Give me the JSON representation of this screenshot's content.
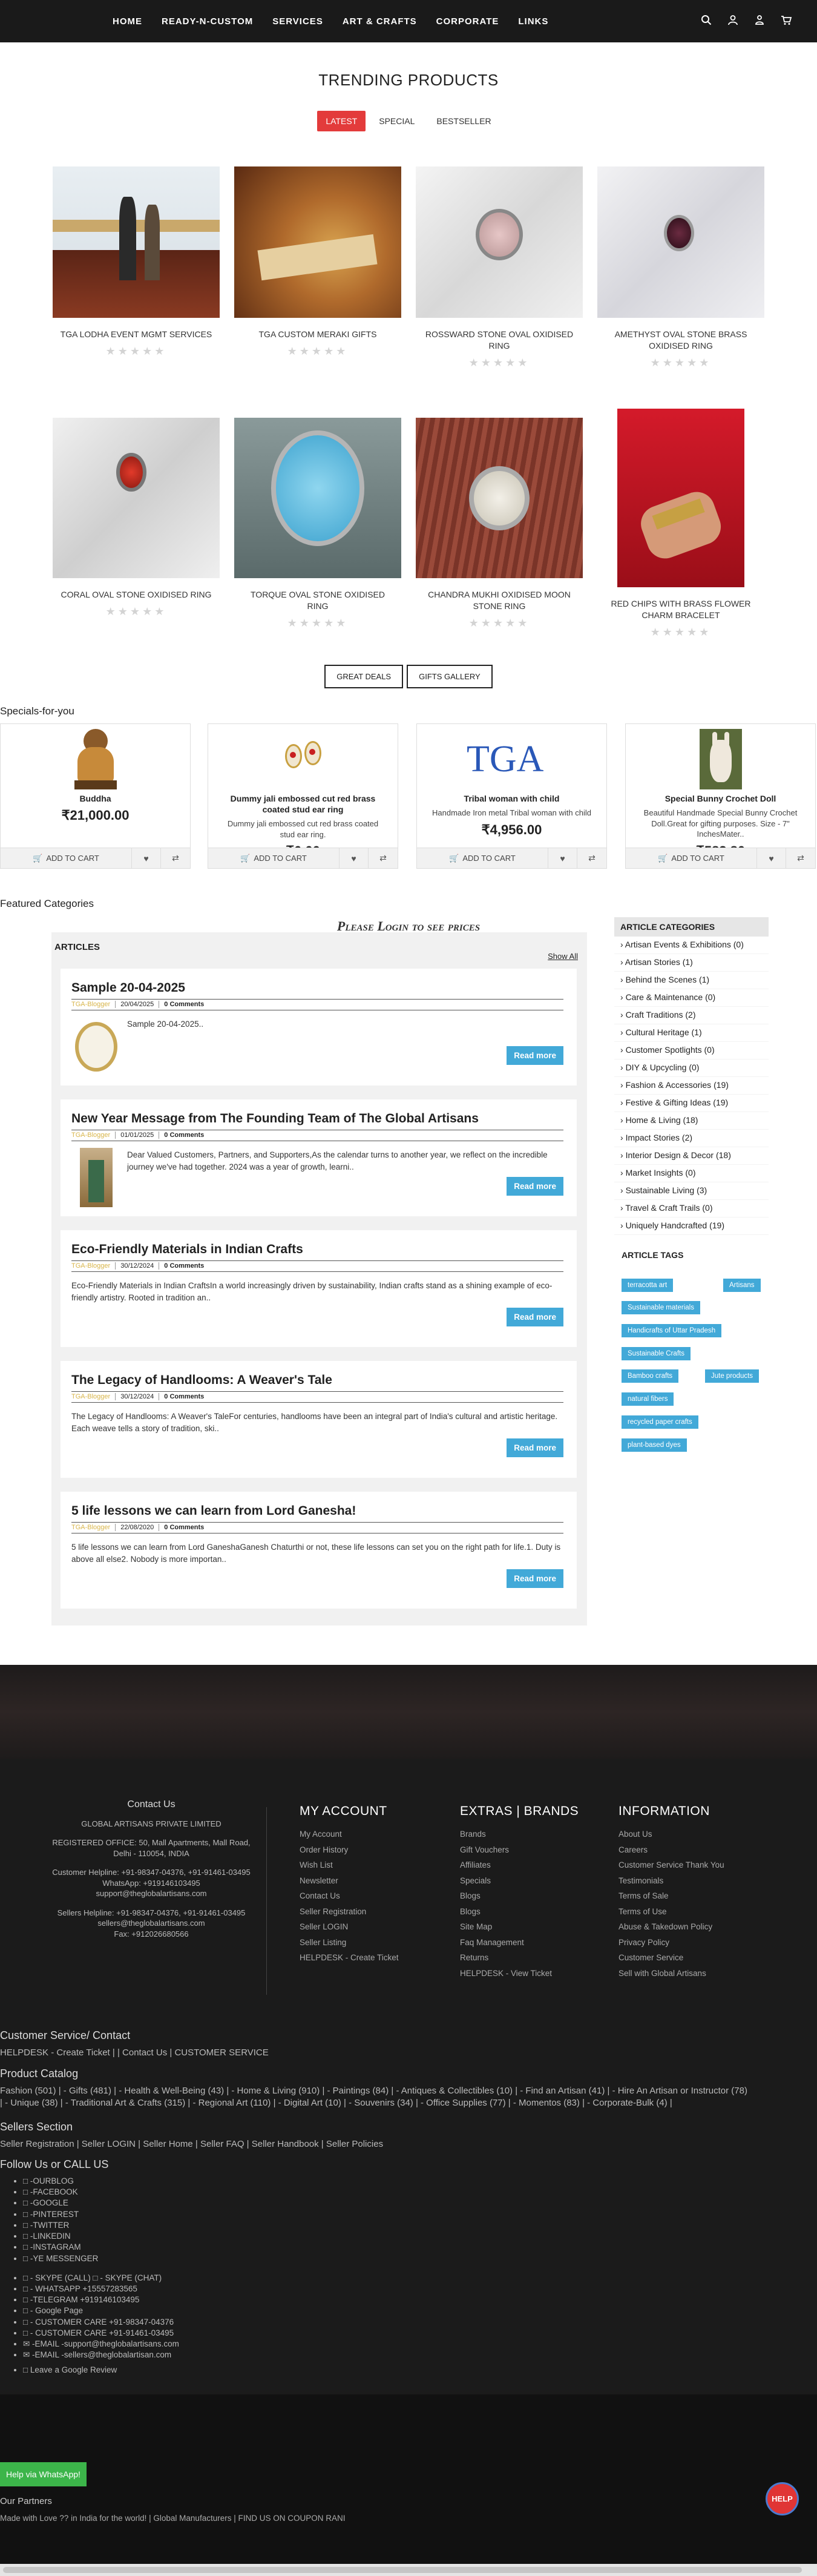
{
  "nav": {
    "items": [
      "HOME",
      "READY-N-CUSTOM",
      "SERVICES",
      "ART & CRAFTS",
      "CORPORATE",
      "LINKS"
    ],
    "icons": [
      "search-icon",
      "user-icon",
      "login-icon",
      "cart-icon"
    ]
  },
  "trending": {
    "title": "TRENDING PRODUCTS",
    "tabs": [
      "LATEST",
      "SPECIAL",
      "BESTSELLER"
    ],
    "products": [
      {
        "name": "TGA LODHA EVENT MGMT SERVICES"
      },
      {
        "name": "TGA CUSTOM MERAKI GIFTS"
      },
      {
        "name": "ROSSWARD STONE OVAL OXIDISED RING"
      },
      {
        "name": "AMETHYST OVAL STONE BRASS OXIDISED RING"
      },
      {
        "name": "CORAL OVAL STONE OXIDISED RING"
      },
      {
        "name": "TORQUE OVAL STONE OXIDISED RING"
      },
      {
        "name": "CHANDRA MUKHI OXIDISED MOON STONE RING"
      },
      {
        "name": "RED CHIPS WITH BRASS FLOWER CHARM BRACELET"
      }
    ],
    "stars": "★★★★★",
    "buttons": [
      "GREAT DEALS",
      "GIFTS GALLERY"
    ]
  },
  "specials": {
    "heading": "Specials-for-you",
    "add_to_cart": "ADD TO CART",
    "items": [
      {
        "name": "Buddha",
        "desc": "",
        "price": "₹21,000.00"
      },
      {
        "name": "Dummy jali embossed cut red brass coated stud ear ring",
        "desc": "Dummy jali embossed cut red brass coated stud ear ring.",
        "price": "₹0.00"
      },
      {
        "name": "Tribal woman with child",
        "desc": "Handmade Iron metal Tribal woman with child",
        "price": "₹4,956.00"
      },
      {
        "name": "Special Bunny Crochet Doll",
        "desc": "Beautiful Handmade Special Bunny Crochet Doll.Great for gifting purposes. Size - 7\" InchesMater..",
        "price": "₹583.80"
      }
    ]
  },
  "featured": {
    "heading": "Featured Categories",
    "login_msg": "Please Login to see prices"
  },
  "articles": {
    "label": "ARTICLES",
    "show_all": "Show All",
    "read_more": "Read more",
    "items": [
      {
        "title": "Sample 20-04-2025",
        "author": "TGA-Blogger",
        "date": "20/04/2025",
        "comments": "0 Comments",
        "excerpt": "Sample 20-04-2025.."
      },
      {
        "title": "New Year Message from The Founding Team of The Global Artisans",
        "author": "TGA-Blogger",
        "date": "01/01/2025",
        "comments": "0 Comments",
        "excerpt": "Dear Valued Customers, Partners, and Supporters,As the calendar turns to another year, we reflect on the incredible journey we've had together. 2024 was a year of growth, learni.."
      },
      {
        "title": "Eco-Friendly Materials in Indian Crafts",
        "author": "TGA-Blogger",
        "date": "30/12/2024",
        "comments": "0 Comments",
        "excerpt": "Eco-Friendly Materials in Indian CraftsIn a world increasingly driven by sustainability, Indian crafts stand as a shining example of eco-friendly artistry. Rooted in tradition an.."
      },
      {
        "title": "The Legacy of Handlooms: A Weaver's Tale",
        "author": "TGA-Blogger",
        "date": "30/12/2024",
        "comments": "0 Comments",
        "excerpt": "The Legacy of Handlooms: A Weaver's TaleFor centuries, handlooms have been an integral part of India's cultural and artistic heritage. Each weave tells a story of tradition, ski.."
      },
      {
        "title": "5 life lessons we can learn from Lord Ganesha!",
        "author": "TGA-Blogger",
        "date": "22/08/2020",
        "comments": "0 Comments",
        "excerpt": "5 life lessons we can learn from Lord GaneshaGanesh Chaturthi or not, these life lessons can set you on the right path for life.1. Duty is above all else2. Nobody is more importan.."
      }
    ]
  },
  "sidebar": {
    "categories_heading": "ARTICLE CATEGORIES",
    "categories": [
      "Artisan Events & Exhibitions (0)",
      "Artisan Stories (1)",
      "Behind the Scenes (1)",
      "Care & Maintenance (0)",
      "Craft Traditions (2)",
      "Cultural Heritage (1)",
      "Customer Spotlights (0)",
      "DIY & Upcycling (0)",
      "Fashion & Accessories (19)",
      "Festive & Gifting Ideas (19)",
      "Home & Living (18)",
      "Impact Stories (2)",
      "Interior Design & Decor (18)",
      "Market Insights (0)",
      "Sustainable Living (3)",
      "Travel & Craft Trails (0)",
      "Uniquely Handcrafted (19)"
    ],
    "tags_heading": "ARTICLE TAGS",
    "tags": [
      "terracotta art",
      "Artisans",
      "Sustainable materials",
      "Handicrafts of Uttar Pradesh",
      "Sustainable Crafts",
      "Bamboo crafts",
      "Jute products",
      "natural fibers",
      "recycled paper crafts",
      "plant-based dyes"
    ]
  },
  "footer": {
    "contact": {
      "title": "Contact Us",
      "company": "GLOBAL ARTISANS PRIVATE LIMITED",
      "address": "REGISTERED OFFICE: 50, Mall Apartments, Mall Road, Delhi - 110054, INDIA",
      "helpline": "Customer Helpline: +91-98347-04376, +91-91461-03495",
      "whatsapp": "WhatsApp: +919146103495",
      "email1": "support@theglobalartisans.com",
      "sellers": "Sellers Helpline: +91-98347-04376, +91-91461-03495",
      "email2": "sellers@theglobalartisans.com",
      "fax": "Fax: +912026680566"
    },
    "my_account": {
      "title": "MY ACCOUNT",
      "links": [
        "My Account",
        "Order History",
        "Wish List",
        "Newsletter",
        "Contact Us",
        "Seller Registration",
        "Seller LOGIN",
        "Seller Listing",
        "HELPDESK - Create Ticket"
      ]
    },
    "extras": {
      "title": "EXTRAS | BRANDS",
      "links": [
        "Brands",
        "Gift Vouchers",
        "Affiliates",
        "Specials",
        "Blogs",
        "Blogs",
        "Site Map",
        "Faq Management",
        "Returns",
        "HELPDESK - View Ticket"
      ]
    },
    "information": {
      "title": "INFORMATION",
      "links": [
        "About Us",
        "Careers",
        "Customer Service Thank You",
        "Testimonials",
        "Terms of Sale",
        "Terms of Use",
        "Abuse & Takedown Policy",
        "Privacy Policy",
        "Customer Service",
        "Sell with Global Artisans"
      ]
    },
    "customer_service": {
      "title": "Customer Service/ Contact",
      "line": "HELPDESK - Create Ticket | | Contact Us | CUSTOMER SERVICE"
    },
    "catalog": {
      "title": "Product Catalog",
      "line1": "Fashion (501) | - Gifts (481) | - Health & Well-Being (43) | - Home & Living (910) | - Paintings (84) | - Antiques & Collectibles (10) | - Find an Artisan (41) | - Hire An Artisan or Instructor (78)",
      "line2": "| - Unique (38) | - Traditional Art & Crafts (315) | - Regional Art (110) | - Digital Art (10) | - Souvenirs (34) | - Office Supplies (77) | - Momentos (83) | - Corporate-Bulk (4) |"
    },
    "sellers": {
      "title": "Sellers Section",
      "line": "Seller Registration | Seller LOGIN | Seller Home | Seller FAQ | Seller Handbook | Seller Policies"
    },
    "follow": {
      "title": "Follow Us or CALL US",
      "social": [
        "□ -OURBLOG",
        "□ -FACEBOOK",
        "□ -GOOGLE",
        "□ -PINTEREST",
        "□ -TWITTER",
        "□ -LINKEDIN",
        "□ -INSTAGRAM",
        "□ -YE MESSENGER"
      ],
      "contacts": [
        "□ - SKYPE (CALL) □ - SKYPE (CHAT)",
        "□ - WHATSAPP +15557283565",
        "□ -TELEGRAM +919146103495",
        "□ - Google Page",
        "□ - CUSTOMER CARE +91-98347-04376",
        "□ - CUSTOMER CARE +91-91461-03495",
        "✉ -EMAIL -support@theglobalartisans.com",
        "✉ -EMAIL -sellers@theglobalartisan.com"
      ],
      "review": "□ Leave a Google Review"
    },
    "whatsapp_btn": "Help via WhatsApp!",
    "partners": "Our Partners",
    "made_with": "Made with Love ?? in India for the world! | Global Manufacturers | FIND US ON COUPON RANI",
    "help_badge": "HELP"
  }
}
